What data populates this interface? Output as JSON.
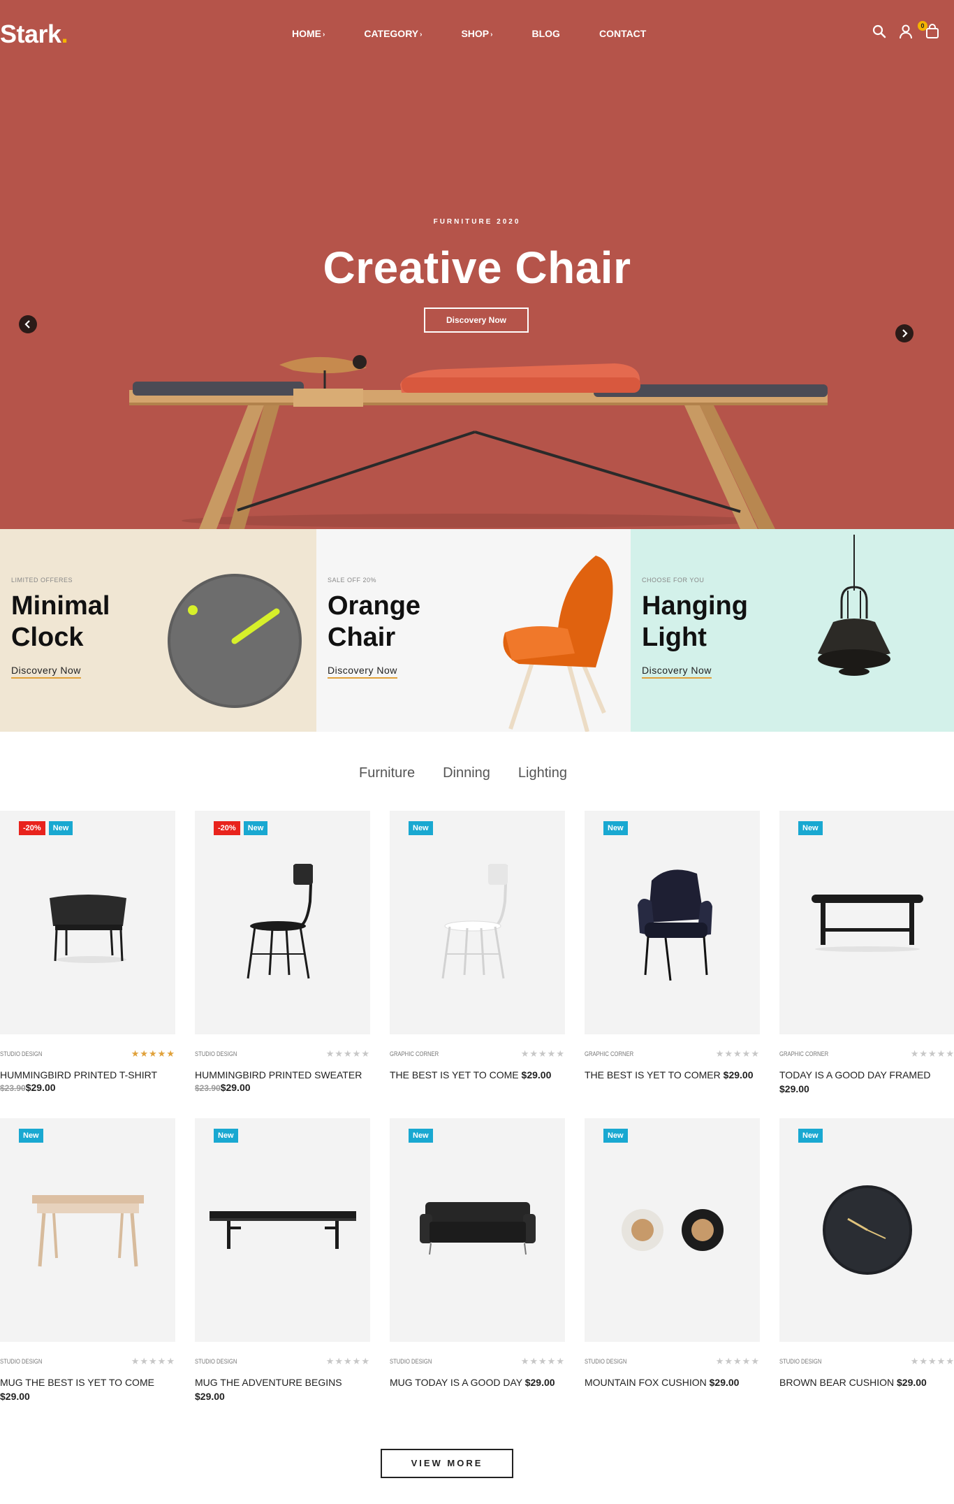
{
  "header": {
    "logo": "Stark",
    "logo_dot": ".",
    "nav": [
      {
        "label": "HOME",
        "caret": true
      },
      {
        "label": "CATEGORY",
        "caret": true
      },
      {
        "label": "SHOP",
        "caret": true
      },
      {
        "label": "BLOG",
        "caret": false
      },
      {
        "label": "CONTACT",
        "caret": false
      }
    ],
    "cart_count": "0"
  },
  "hero": {
    "eyebrow": "FURNITURE 2020",
    "title": "Creative Chair",
    "button": "Discovery Now",
    "bg_color": "#b5544a"
  },
  "banners": [
    {
      "eyebrow": "LIMITED OFFERES",
      "title": "Minimal Clock",
      "link": "Discovery Now",
      "bg": "#f0e6d3"
    },
    {
      "eyebrow": "SALE OFF 20%",
      "title": "Orange Chair",
      "link": "Discovery Now",
      "bg": "#f6f6f6"
    },
    {
      "eyebrow": "CHOOSE FOR YOU",
      "title": "Hanging Light",
      "link": "Discovery Now",
      "bg": "#d3f1ea"
    }
  ],
  "tabs": [
    "Furniture",
    "Dinning",
    "Lighting"
  ],
  "products": [
    {
      "vendor": "STUDIO DESIGN",
      "stars": "★★★★★",
      "rated": true,
      "name": "HUMMINGBIRD PRINTED T-SHIRT",
      "old_price": "$23.90",
      "price": "$29.00",
      "badges": [
        "-20%",
        "New"
      ],
      "art": "chair-black"
    },
    {
      "vendor": "STUDIO DESIGN",
      "stars": "★★★★★",
      "rated": false,
      "name": "HUMMINGBIRD PRINTED SWEATER",
      "old_price": "$23.90",
      "price": "$29.00",
      "badges": [
        "-20%",
        "New"
      ],
      "art": "stool-black"
    },
    {
      "vendor": "GRAPHIC CORNER",
      "stars": "★★★★★",
      "rated": false,
      "name": "THE BEST IS YET TO COME",
      "old_price": "",
      "price": "$29.00",
      "badges": [
        "New"
      ],
      "art": "stool-white"
    },
    {
      "vendor": "GRAPHIC CORNER",
      "stars": "★★★★★",
      "rated": false,
      "name": "THE BEST IS YET TO COMER",
      "old_price": "",
      "price": "$29.00",
      "badges": [
        "New"
      ],
      "art": "armchair-navy"
    },
    {
      "vendor": "GRAPHIC CORNER",
      "stars": "★★★★★",
      "rated": false,
      "name": "TODAY IS A GOOD DAY FRAMED",
      "old_price": "",
      "price": "$29.00",
      "badges": [
        "New"
      ],
      "art": "bench-black"
    },
    {
      "vendor": "STUDIO DESIGN",
      "stars": "★★★★★",
      "rated": false,
      "name": "MUG THE BEST IS YET TO COME",
      "old_price": "",
      "price": "$29.00",
      "badges": [
        "New"
      ],
      "art": "table-wood"
    },
    {
      "vendor": "STUDIO DESIGN",
      "stars": "★★★★★",
      "rated": false,
      "name": "MUG THE ADVENTURE BEGINS",
      "old_price": "",
      "price": "$29.00",
      "badges": [
        "New"
      ],
      "art": "long-bench"
    },
    {
      "vendor": "STUDIO DESIGN",
      "stars": "★★★★★",
      "rated": false,
      "name": "MUG TODAY IS A GOOD DAY",
      "old_price": "",
      "price": "$29.00",
      "badges": [
        "New"
      ],
      "art": "sofa"
    },
    {
      "vendor": "STUDIO DESIGN",
      "stars": "★★★★★",
      "rated": false,
      "name": "MOUNTAIN FOX CUSHION",
      "old_price": "",
      "price": "$29.00",
      "badges": [
        "New"
      ],
      "art": "jars"
    },
    {
      "vendor": "STUDIO DESIGN",
      "stars": "★★★★★",
      "rated": false,
      "name": "BROWN BEAR CUSHION",
      "old_price": "",
      "price": "$29.00",
      "badges": [
        "New"
      ],
      "art": "wall-clock"
    }
  ],
  "view_more": "VIEW MORE"
}
